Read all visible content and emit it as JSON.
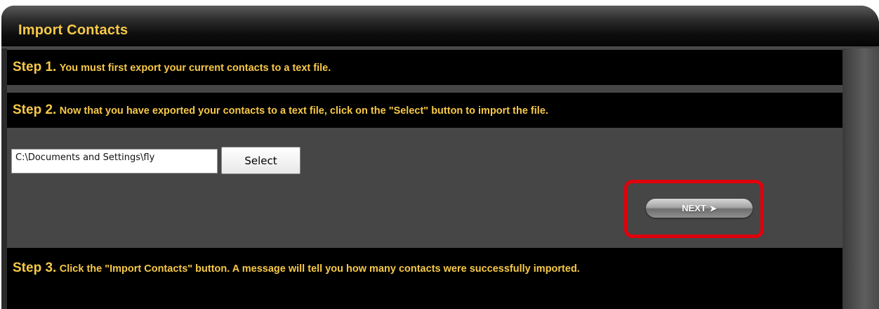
{
  "header": {
    "title": "Import Contacts"
  },
  "steps": [
    {
      "label": "Step 1.",
      "text": "You must first export your current contacts to a text file."
    },
    {
      "label": "Step 2.",
      "text": "Now that you have exported your contacts to a text file, click on the \"Select\" button to import the file."
    },
    {
      "label": "Step 3.",
      "text": "Click the \"Import Contacts\" button. A message will tell you how many contacts were successfully imported."
    }
  ],
  "file_picker": {
    "value": "C:\\Documents and Settings\\fly",
    "select_label": "Select"
  },
  "next_button": {
    "label": "NEXT",
    "icon": "chevron-right-icon"
  },
  "colors": {
    "accent_text": "#f7c948",
    "highlight_border": "#e0000b",
    "panel_background": "#464646"
  }
}
